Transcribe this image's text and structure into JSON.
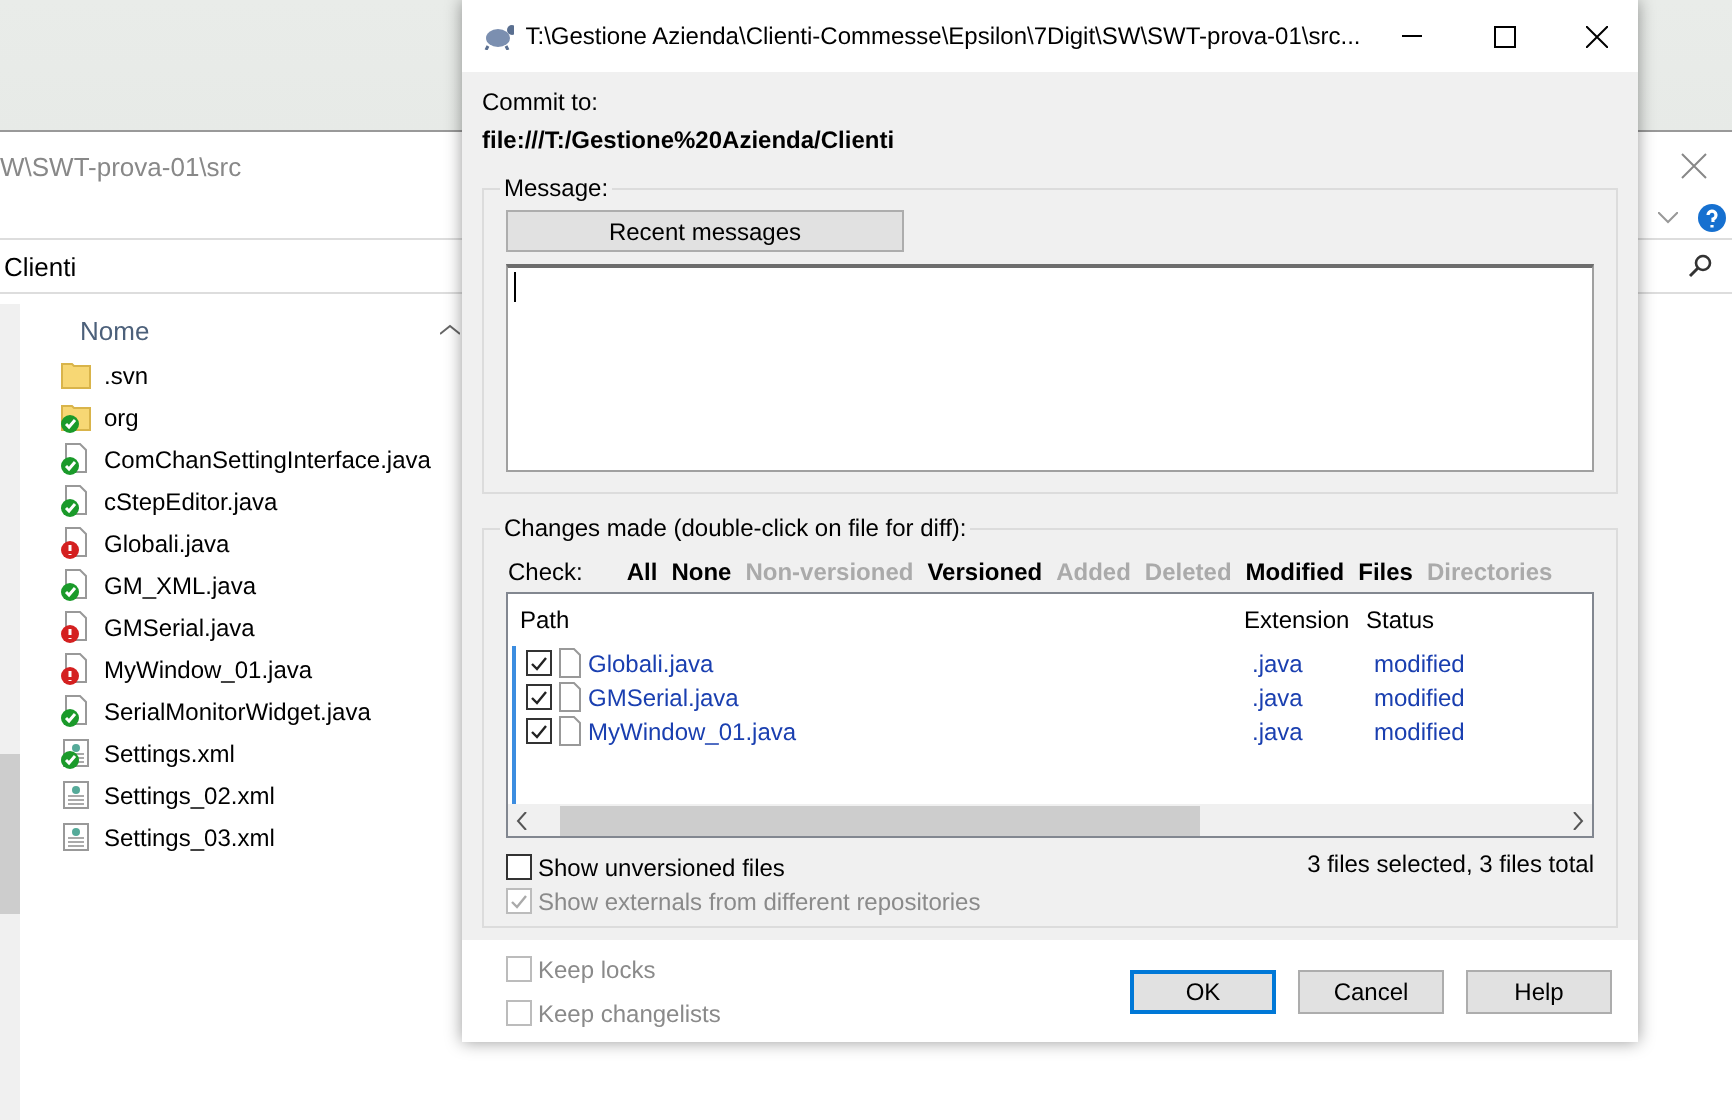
{
  "explorer": {
    "title": "W\\SWT-prova-01\\src",
    "address": "Clienti",
    "column": "Nome",
    "files": [
      {
        "name": ".svn",
        "kind": "folder",
        "versioned": false
      },
      {
        "name": "org",
        "kind": "folder",
        "versioned": true,
        "modified": false
      },
      {
        "name": "ComChanSettingInterface.java",
        "kind": "file",
        "versioned": true,
        "modified": false
      },
      {
        "name": "cStepEditor.java",
        "kind": "file",
        "versioned": true,
        "modified": false
      },
      {
        "name": "Globali.java",
        "kind": "file",
        "versioned": true,
        "modified": true
      },
      {
        "name": "GM_XML.java",
        "kind": "file",
        "versioned": true,
        "modified": false
      },
      {
        "name": "GMSerial.java",
        "kind": "file",
        "versioned": true,
        "modified": true
      },
      {
        "name": "MyWindow_01.java",
        "kind": "file",
        "versioned": true,
        "modified": true
      },
      {
        "name": "SerialMonitorWidget.java",
        "kind": "file",
        "versioned": true,
        "modified": false
      },
      {
        "name": "Settings.xml",
        "kind": "xml",
        "versioned": true,
        "modified": false
      },
      {
        "name": "Settings_02.xml",
        "kind": "xml",
        "versioned": false
      },
      {
        "name": "Settings_03.xml",
        "kind": "xml",
        "versioned": false
      }
    ]
  },
  "dialog": {
    "title": "T:\\Gestione Azienda\\Clienti-Commesse\\Epsilon\\7Digit\\SW\\SWT-prova-01\\src...",
    "commit_label": "Commit to:",
    "commit_url": "file:///T:/Gestione%20Azienda/Clienti",
    "message_group": "Message:",
    "recent_button": "Recent messages",
    "changes_group": "Changes made (double-click on file for diff):",
    "check_label": "Check:",
    "check_links": [
      {
        "label": "All",
        "enabled": true
      },
      {
        "label": "None",
        "enabled": true
      },
      {
        "label": "Non-versioned",
        "enabled": false
      },
      {
        "label": "Versioned",
        "enabled": true
      },
      {
        "label": "Added",
        "enabled": false
      },
      {
        "label": "Deleted",
        "enabled": false
      },
      {
        "label": "Modified",
        "enabled": true
      },
      {
        "label": "Files",
        "enabled": true
      },
      {
        "label": "Directories",
        "enabled": false
      }
    ],
    "columns": [
      "Path",
      "Extension",
      "Status"
    ],
    "rows": [
      {
        "path": "Globali.java",
        "extension": ".java",
        "status": "modified",
        "checked": true
      },
      {
        "path": "GMSerial.java",
        "extension": ".java",
        "status": "modified",
        "checked": true
      },
      {
        "path": "MyWindow_01.java",
        "extension": ".java",
        "status": "modified",
        "checked": true
      }
    ],
    "options": [
      {
        "label": "Show unversioned files",
        "checked": false,
        "disabled": false
      },
      {
        "label": "Show externals from different repositories",
        "checked": true,
        "disabled": true
      }
    ],
    "summary": "3 files selected, 3 files total",
    "keep": [
      {
        "label": "Keep locks",
        "checked": false,
        "disabled": true
      },
      {
        "label": "Keep changelists",
        "checked": false,
        "disabled": true
      }
    ],
    "buttons": [
      {
        "label": "OK",
        "focused": true
      },
      {
        "label": "Cancel",
        "focused": false
      },
      {
        "label": "Help",
        "focused": false
      }
    ]
  }
}
